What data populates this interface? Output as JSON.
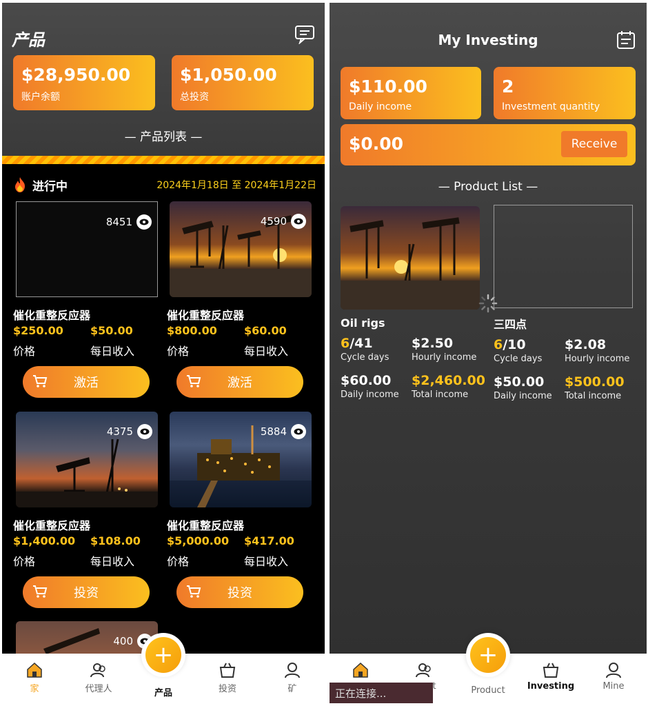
{
  "left": {
    "title": "产品",
    "balance": {
      "value": "$28,950.00",
      "label": "账户余额"
    },
    "invest": {
      "value": "$1,050.00",
      "label": "总投资"
    },
    "section": "— 产品列表 —",
    "ongoing": {
      "label": "进行中",
      "date": "2024年1月18日 至 2024年1月22日"
    },
    "products": [
      {
        "views": "8451",
        "name": "催化重整反应器",
        "price": "$250.00",
        "daily": "$50.00",
        "price_label": "价格",
        "daily_label": "每日收入",
        "button": "激活"
      },
      {
        "views": "4590",
        "name": "催化重整反应器",
        "price": "$800.00",
        "daily": "$60.00",
        "price_label": "价格",
        "daily_label": "每日收入",
        "button": "激活"
      },
      {
        "views": "4375",
        "name": "催化重整反应器",
        "price": "$1,400.00",
        "daily": "$108.00",
        "price_label": "价格",
        "daily_label": "每日收入",
        "button": "投资"
      },
      {
        "views": "5884",
        "name": "催化重整反应器",
        "price": "$5,000.00",
        "daily": "$417.00",
        "price_label": "价格",
        "daily_label": "每日收入",
        "button": "投资"
      },
      {
        "views": "400"
      }
    ],
    "nav": [
      "家",
      "代理人",
      "产品",
      "投资",
      "矿"
    ]
  },
  "right": {
    "title": "My Investing",
    "daily": {
      "value": "$110.00",
      "label": "Daily income"
    },
    "quantity": {
      "value": "2",
      "label": "Investment quantity"
    },
    "receive": {
      "value": "$0.00",
      "button": "Receive"
    },
    "section": "— Product List —",
    "products": [
      {
        "name": "Oil rigs",
        "cycle_done": "6",
        "cycle_total": "/41",
        "cycle_label": "Cycle days",
        "hourly": "$2.50",
        "hourly_label": "Hourly income",
        "daily": "$60.00",
        "daily_label": "Daily income",
        "total": "$2,460.00",
        "total_label": "Total income"
      },
      {
        "name": "三四点",
        "cycle_done": "6",
        "cycle_total": "/10",
        "cycle_label": "Cycle days",
        "hourly": "$2.08",
        "hourly_label": "Hourly income",
        "daily": "$50.00",
        "daily_label": "Daily income",
        "total": "$500.00",
        "total_label": "Total income"
      }
    ],
    "nav": [
      "",
      "t",
      "Product",
      "Investing",
      "Mine"
    ],
    "toast": "正在连接..."
  },
  "colors": {
    "accent_start": "#f07a2a",
    "accent_end": "#fbbf1f",
    "gold": "#ffc21c",
    "nav_active": "#f5a623"
  }
}
